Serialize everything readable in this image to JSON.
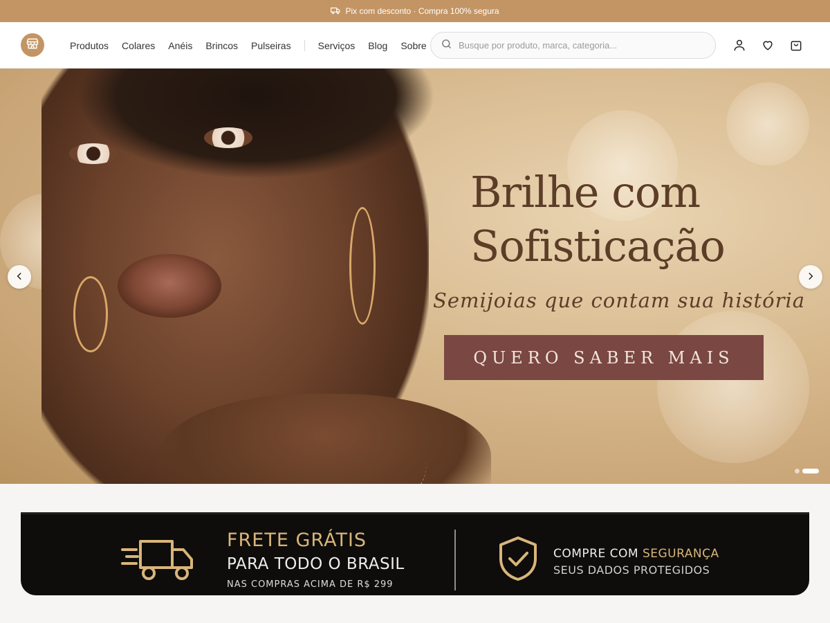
{
  "announcement": {
    "text": "Pix com desconto · Compra 100% segura",
    "icon": "truck-icon"
  },
  "header": {
    "logo_icon": "store-icon",
    "nav": [
      {
        "label": "Produtos"
      },
      {
        "label": "Colares"
      },
      {
        "label": "Anéis"
      },
      {
        "label": "Brincos"
      },
      {
        "label": "Pulseiras"
      }
    ],
    "nav_secondary": [
      {
        "label": "Serviços"
      },
      {
        "label": "Blog"
      },
      {
        "label": "Sobre"
      }
    ],
    "search": {
      "placeholder": "Busque por produto, marca, categoria...",
      "value": ""
    },
    "icons": [
      "user-icon",
      "heart-icon",
      "shopping-bag-icon"
    ]
  },
  "hero": {
    "title_line1": "Brilhe com",
    "title_line2": "Sofisticação",
    "subtitle": "Semijoias que contam sua história",
    "cta": "QUERO SABER MAIS",
    "slides_count": 2,
    "active_slide": 2
  },
  "benefits": {
    "shipping": {
      "title": "FRETE GRÁTIS",
      "line2": "PARA TODO O BRASIL",
      "line3": "NAS COMPRAS ACIMA DE R$ 299"
    },
    "security": {
      "line1_a": "COMPRE COM ",
      "line1_b": "SEGURANÇA",
      "line2": "SEUS DADOS PROTEGIDOS"
    }
  },
  "colors": {
    "brand": "#c39564",
    "cta": "#7a4743",
    "hero_text": "#5c3d27",
    "banner_bg": "#0e0d0b",
    "gold": "#d9b57a"
  }
}
